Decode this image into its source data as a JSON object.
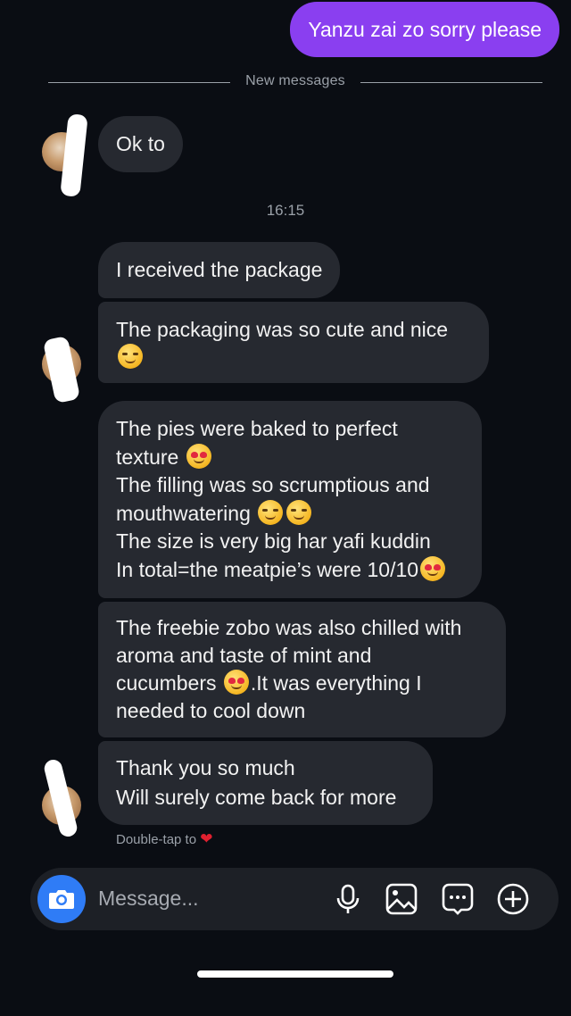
{
  "outgoing": {
    "text": "Yanzu zai zo sorry please"
  },
  "divider": {
    "label": "New messages"
  },
  "messages_before": [
    {
      "text": "Ok to"
    }
  ],
  "timestamp": "16:15",
  "messages_after": [
    {
      "lines": [
        "I received the package"
      ]
    },
    {
      "lines": [
        "The packaging was so cute and nice"
      ],
      "emoji_line": "😊"
    },
    {
      "lines": [
        "The pies were baked to perfect",
        "texture",
        "The filling was so scrumptious and",
        "mouthwatering",
        "The size is very big har yafi kuddin",
        "In total=the meatpie’s were 10/10"
      ]
    },
    {
      "lines": [
        "The freebie zobo was also chilled with",
        "aroma and taste of mint and",
        "cucumbers",
        ".It was everything I",
        "needed to cool down"
      ]
    },
    {
      "lines": [
        "Thank you so much",
        "Will surely come back for more"
      ]
    }
  ],
  "reaction_hint": {
    "text": "Double-tap to",
    "icon": "heart-icon"
  },
  "composer": {
    "placeholder": "Message...",
    "camera_icon": "camera-icon",
    "tools": [
      "microphone-icon",
      "gallery-icon",
      "sticker-icon",
      "plus-icon"
    ]
  },
  "colors": {
    "background": "#0a0d13",
    "outgoing_bubble": "#8a3ff0",
    "incoming_bubble": "#262930",
    "camera_button": "#2f7cf6"
  }
}
